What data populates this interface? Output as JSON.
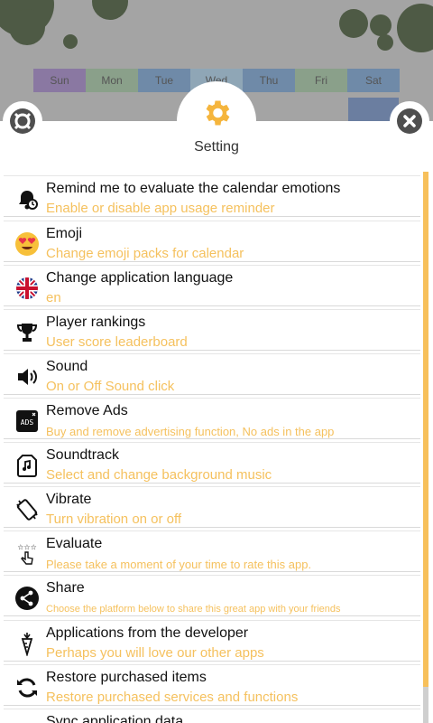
{
  "calendar": {
    "weekdays": [
      "Sun",
      "Mon",
      "Tue",
      "Wed",
      "Thu",
      "Fri",
      "Sat"
    ],
    "weekday_colors": [
      "#8a78a2",
      "#8aa08a",
      "#6f8aa8",
      "#8fa6b6",
      "#6f8aa8",
      "#8aa08a",
      "#6f8aa8"
    ]
  },
  "header": {
    "title": "Setting",
    "accent": "#f5c15e"
  },
  "settings": [
    {
      "title": "Remind me to evaluate the calendar emotions",
      "subtitle": "Enable or disable app usage reminder",
      "icon": "alarm-bell-icon"
    },
    {
      "title": "Emoji",
      "subtitle": "Change emoji packs for calendar",
      "icon": "heart-eyes-emoji-icon"
    },
    {
      "title": "Change application language",
      "subtitle": "en",
      "icon": "uk-flag-icon"
    },
    {
      "title": "Player rankings",
      "subtitle": "User score leaderboard",
      "icon": "trophy-icon"
    },
    {
      "title": "Sound",
      "subtitle": "On or Off Sound click",
      "icon": "speaker-icon"
    },
    {
      "title": "Remove Ads",
      "subtitle": "Buy and remove advertising function, No ads in the app",
      "icon": "ads-icon"
    },
    {
      "title": "Soundtrack",
      "subtitle": "Select and change background music",
      "icon": "music-file-icon"
    },
    {
      "title": "Vibrate",
      "subtitle": "Turn vibration on or off",
      "icon": "vibrate-phone-icon"
    },
    {
      "title": "Evaluate",
      "subtitle": "Please take a moment of your time to rate this app.",
      "icon": "rate-stars-icon"
    },
    {
      "title": "Share",
      "subtitle": "Choose the platform below to share this great app with your friends",
      "icon": "share-icon"
    },
    {
      "title": "Applications from the developer",
      "subtitle": "Perhaps you will love our other apps",
      "icon": "carrot-icon"
    },
    {
      "title": "Restore purchased items",
      "subtitle": "Restore purchased services and functions",
      "icon": "restore-icon"
    },
    {
      "title": "Sync application data",
      "subtitle": "",
      "icon": "sync-icon"
    }
  ]
}
